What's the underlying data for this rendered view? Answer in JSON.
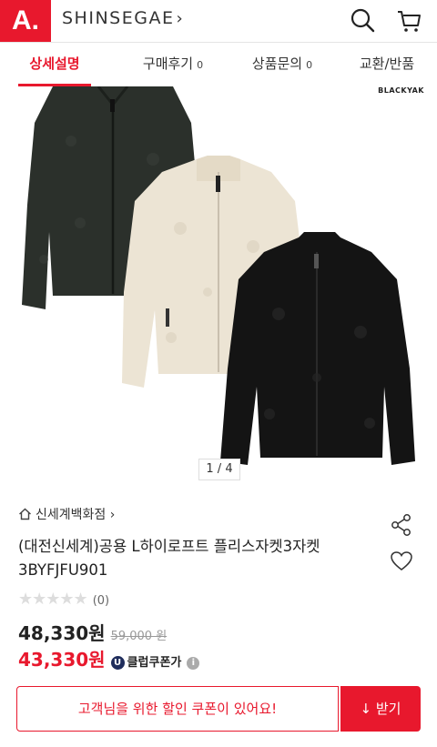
{
  "header": {
    "logo": "A.",
    "brand": "SHINSEGAE",
    "brand_chevron": "›",
    "icons": [
      "search-icon",
      "cart-icon"
    ]
  },
  "tabs": [
    {
      "label": "상세설명",
      "count": "",
      "active": true
    },
    {
      "label": "구매후기",
      "count": "0",
      "active": false
    },
    {
      "label": "상품문의",
      "count": "0",
      "active": false
    },
    {
      "label": "교환/반품",
      "count": "",
      "active": false
    }
  ],
  "gallery": {
    "brand_mark": "BLACKYAK",
    "pager": "1 / 4",
    "jacket_colors": [
      "#2b302b",
      "#ece4d4",
      "#141414"
    ]
  },
  "product": {
    "store": "신세계백화점",
    "store_chevron": "›",
    "title": "(대전신세계)공용 L하이로프트 플리스자켓3자켓 3BYFJFU901",
    "stars": "★★★★★",
    "rating_score": 0,
    "review_count": "(0)",
    "price": "48,330원",
    "original_price": "59,000 원",
    "coupon_price": "43,330원",
    "coupon_badge": "U",
    "coupon_label": "클럽쿠폰가",
    "info_icon": "i"
  },
  "coupon_bar": {
    "message": "고객님을 위한 할인 쿠폰이 있어요!",
    "button": "↓ 받기"
  },
  "colors": {
    "accent": "#e8182d",
    "coupon_badge": "#1f2d5c"
  }
}
